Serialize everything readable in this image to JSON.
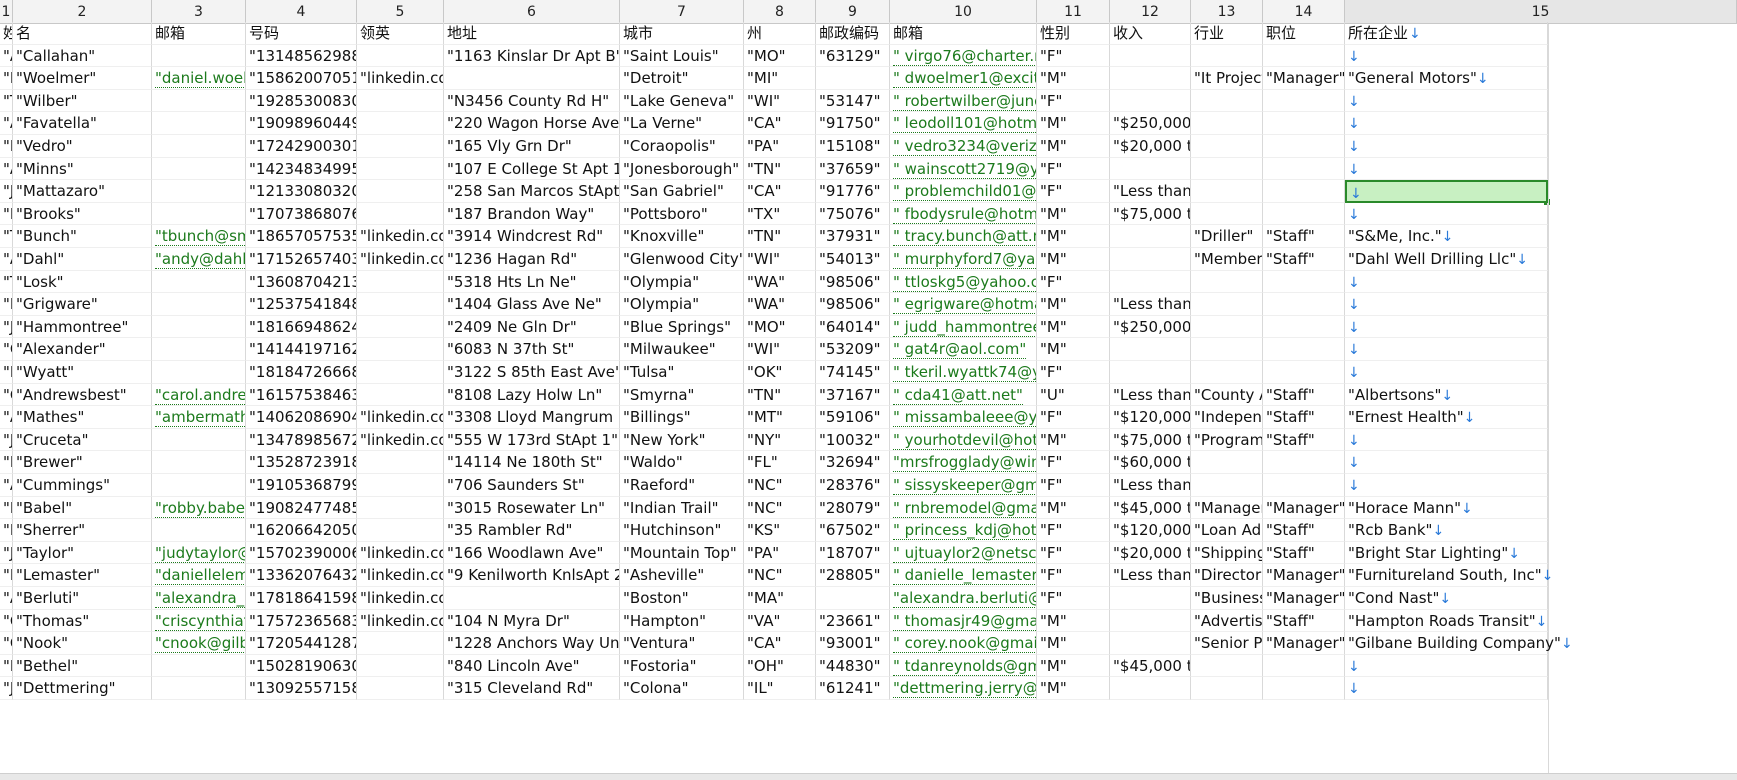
{
  "column_numbers": [
    "1",
    "2",
    "3",
    "4",
    "5",
    "6",
    "7",
    "8",
    "9",
    "10",
    "11",
    "12",
    "13",
    "14",
    "15"
  ],
  "headers": [
    "姓",
    "名",
    "邮箱",
    "号码",
    "领英",
    "地址",
    "城市",
    "州",
    "邮政编码",
    "邮箱",
    "性别",
    "收入",
    "行业",
    "职位",
    "所在企业"
  ],
  "rows": [
    [
      "\"Am",
      "\"Callahan\"",
      "",
      "\"13148562988\"",
      "",
      "\"1163 Kinslar Dr Apt B\"",
      "\"Saint Louis\"",
      "\"MO\"",
      "\"63129\"",
      "\" virgo76@charter.ne",
      "\"F\"",
      "",
      "",
      "",
      ""
    ],
    [
      "\"Da",
      "\"Woelmer\"",
      "\"daniel.woelm",
      "\"15862007051\"",
      "\"linkedin.con",
      "",
      "\"Detroit\"",
      "\"MI\"",
      "",
      "\" dwoelmer1@excite.",
      "\"M\"",
      "",
      "\"It Project",
      "\"Manager\"",
      "\"General Motors\""
    ],
    [
      "\"Tar",
      "\"Wilber\"",
      "",
      "\"19285300830\"",
      "",
      "\"N3456 County Rd H\"",
      "\"Lake Geneva\"",
      "\"WI\"",
      "\"53147\"",
      "\" robertwilber@juno.",
      "\"F\"",
      "",
      "",
      "",
      ""
    ],
    [
      "\"Aar",
      "\"Favatella\"",
      "",
      "\"19098960449\"",
      "",
      "\"220 Wagon Horse Ave\"",
      "\"La Verne\"",
      "\"CA\"",
      "\"91750\"",
      "\" leodoll101@hotmai",
      "\"M\"",
      "\"$250,000+",
      "",
      "",
      ""
    ],
    [
      "\"Pat",
      "\"Vedro\"",
      "",
      "\"17242900301\"",
      "",
      "\"165 Vly Grn Dr\"",
      "\"Coraopolis\"",
      "\"PA\"",
      "\"15108\"",
      "\" vedro3234@verizor",
      "\"M\"",
      "\"$20,000 to",
      "",
      "",
      ""
    ],
    [
      "\"Apr",
      "\"Minns\"",
      "",
      "\"14234834995\"",
      "",
      "\"107 E College St Apt 15\"",
      "\"Jonesborough\"",
      "\"TN\"",
      "\"37659\"",
      "\" wainscott2719@yah",
      "\"F\"",
      "",
      "",
      "",
      ""
    ],
    [
      "\"Jos",
      "\"Mattazaro\"",
      "",
      "\"12133080320\"",
      "",
      "\"258 San Marcos StApt K",
      "\"San Gabriel\"",
      "\"CA\"",
      "\"91776\"",
      "\" problemchild01@g",
      "\"F\"",
      "\"Less than $",
      "",
      "",
      ""
    ],
    [
      "\"Dav",
      "\"Brooks\"",
      "",
      "\"17073868076\"",
      "",
      "\"187 Brandon Way\"",
      "\"Pottsboro\"",
      "\"TX\"",
      "\"75076\"",
      "\" fbodysrule@hotma",
      "\"M\"",
      "\"$75,000 to",
      "",
      "",
      ""
    ],
    [
      "\"Tra",
      "\"Bunch\"",
      "\"tbunch@sme",
      "\"18657057535\"",
      "\"linkedin.con",
      "\"3914 Windcrest Rd\"",
      "\"Knoxville\"",
      "\"TN\"",
      "\"37931\"",
      "\" tracy.bunch@att.ne",
      "\"M\"",
      "",
      "\"Driller\"",
      "\"Staff\"",
      "\"S&Me, Inc.\""
    ],
    [
      "\"And",
      "\"Dahl\"",
      "\"andy@dahlw",
      "\"17152657403\"",
      "\"linkedin.con",
      "\"1236 Hagan Rd\"",
      "\"Glenwood City\"",
      "\"WI\"",
      "\"54013\"",
      "\" murphyford7@yaho",
      "\"M\"",
      "",
      "\"Member\"",
      "\"Staff\"",
      "\"Dahl Well Drilling Llc\""
    ],
    [
      "\"Tar",
      "\"Losk\"",
      "",
      "\"13608704213\"",
      "",
      "\"5318 Hts Ln Ne\"",
      "\"Olympia\"",
      "\"WA\"",
      "\"98506\"",
      "\" ttloskg5@yahoo.co",
      "\"F\"",
      "",
      "",
      "",
      ""
    ],
    [
      "\"Mic",
      "\"Grigware\"",
      "",
      "\"12537541848\"",
      "",
      "\"1404 Glass Ave Ne\"",
      "\"Olympia\"",
      "\"WA\"",
      "\"98506\"",
      "\" egrigware@hotmai",
      "\"M\"",
      "\"Less than $",
      "",
      "",
      ""
    ],
    [
      "\"Jud",
      "\"Hammontree\"",
      "",
      "\"18166948624\"",
      "",
      "\"2409 Ne Gln Dr\"",
      "\"Blue Springs\"",
      "\"MO\"",
      "\"64014\"",
      "\" judd_hammontree8",
      "\"M\"",
      "\"$250,000+",
      "",
      "",
      ""
    ],
    [
      "\"Gat",
      "\"Alexander\"",
      "",
      "\"14144197162\"",
      "",
      "\"6083 N 37th St\"",
      "\"Milwaukee\"",
      "\"WI\"",
      "\"53209\"",
      "\" gat4r@aol.com\"",
      "\"M\"",
      "",
      "",
      "",
      ""
    ],
    [
      "\"Ker",
      "\"Wyatt\"",
      "",
      "\"18184726668\"",
      "",
      "\"3122 S 85th East Ave\"",
      "\"Tulsa\"",
      "\"OK\"",
      "\"74145\"",
      "\" tkeril.wyattk74@yal",
      "\"F\"",
      "",
      "",
      "",
      ""
    ],
    [
      "\"Car",
      "\"Andrewsbest\"",
      "\"carol.andrew",
      "\"16157538463\"",
      "",
      "\"8108 Lazy Holw Ln\"",
      "\"Smyrna\"",
      "\"TN\"",
      "\"37167\"",
      "\" cda41@att.net\"",
      "\"U\"",
      "\"Less than $",
      "\"County A",
      "\"Staff\"",
      "\"Albertsons\""
    ],
    [
      "\"Am",
      "\"Mathes\"",
      "\"ambermathe",
      "\"14062086904\"",
      "\"linkedin.con",
      "\"3308 Lloyd Mangrum Ln",
      "\"Billings\"",
      "\"MT\"",
      "\"59106\"",
      "\" missambaleee@yah",
      "\"F\"",
      "\"$120,000 t",
      "\"Independ",
      "\"Staff\"",
      "\"Ernest Health\""
    ],
    [
      "\"Jos",
      "\"Cruceta\"",
      "",
      "\"13478985672\"",
      "\"linkedin.con",
      "\"555 W 173rd StApt 1\"",
      "\"New York\"",
      "\"NY\"",
      "\"10032\"",
      "\" yourhotdevil@hotn",
      "\"M\"",
      "\"$75,000 to",
      "\"Programn",
      "\"Staff\"",
      ""
    ],
    [
      "\"Ker",
      "\"Brewer\"",
      "",
      "\"13528723918\"",
      "",
      "\"14114 Ne 180th St\"",
      "\"Waldo\"",
      "\"FL\"",
      "\"32694\"",
      "\"mrsfrogglady@wind",
      "\"F\"",
      "\"$60,000 to",
      "",
      "",
      ""
    ],
    [
      "\"Aur",
      "\"Cummings\"",
      "",
      "\"19105368799\"",
      "",
      "\"706 Saunders St\"",
      "\"Raeford\"",
      "\"NC\"",
      "\"28376\"",
      "\" sissyskeeper@gmai",
      "\"F\"",
      "\"Less than $",
      "",
      "",
      ""
    ],
    [
      "\"Rol",
      "\"Babel\"",
      "\"robby.babel@",
      "\"19082477485\"",
      "",
      "\"3015 Rosewater Ln\"",
      "\"Indian Trail\"",
      "\"NC\"",
      "\"28079\"",
      "\" rnbremodel@gmail",
      "\"M\"",
      "\"$45,000 to",
      "\"Manager\"",
      "\"Manager\"",
      "\"Horace Mann\""
    ],
    [
      "\"Kris",
      "\"Sherrer\"",
      "",
      "\"16206642050\"",
      "",
      "\"35 Rambler Rd\"",
      "\"Hutchinson\"",
      "\"KS\"",
      "\"67502\"",
      "\" princess_kdj@hotm",
      "\"F\"",
      "\"$120,000 t",
      "\"Loan Adm",
      "\"Staff\"",
      "\"Rcb Bank\""
    ],
    [
      "\"Jud",
      "\"Taylor\"",
      "\"judytaylor@f",
      "\"15702390006\"",
      "\"linkedin.con",
      "\"166 Woodlawn Ave\"",
      "\"Mountain Top\"",
      "\"PA\"",
      "\"18707\"",
      "\" ujtuaylor2@netscap",
      "\"F\"",
      "\"$20,000 to",
      "\"Shipping\"",
      "\"Staff\"",
      "\"Bright Star Lighting\""
    ],
    [
      "\"Dar",
      "\"Lemaster\"",
      "\"daniellelema",
      "\"13362076432\"",
      "\"linkedin.con",
      "\"9 Kenilworth KnlsApt 20",
      "\"Asheville\"",
      "\"NC\"",
      "\"28805\"",
      "\" danielle_lemaster@",
      "\"F\"",
      "\"Less than $",
      "\"Director C",
      "\"Manager\"",
      "\"Furnitureland South, Inc\""
    ],
    [
      "\"Ale",
      "\"Berluti\"",
      "\"alexandra_be",
      "\"17818641598\"",
      "\"linkedin.con",
      "",
      "\"Boston\"",
      "\"MA\"",
      "",
      "\"alexandra.berluti@g",
      "\"F\"",
      "",
      "\"Business I",
      "\"Manager\"",
      "\"Cond Nast\""
    ],
    [
      "\"Cris",
      "\"Thomas\"",
      "\"criscynthiath",
      "\"17572365683\"",
      "\"linkedin.con",
      "\"104 N Myra Dr\"",
      "\"Hampton\"",
      "\"VA\"",
      "\"23661\"",
      "\" thomasjr49@gmail.",
      "\"M\"",
      "",
      "\"Advertisir",
      "\"Staff\"",
      "\"Hampton Roads Transit\""
    ],
    [
      "\"Cor",
      "\"Nook\"",
      "\"cnook@gilba",
      "\"17205441287\"",
      "",
      "\"1228 Anchors Way Unit",
      "\"Ventura\"",
      "\"CA\"",
      "\"93001\"",
      "\" corey.nook@gmail.c",
      "\"M\"",
      "",
      "\"Senior Pr",
      "\"Manager\"",
      "\"Gilbane Building Company\""
    ],
    [
      "\"Dar",
      "\"Bethel\"",
      "",
      "\"15028190630\"",
      "",
      "\"840 Lincoln Ave\"",
      "\"Fostoria\"",
      "\"OH\"",
      "\"44830\"",
      "\" tdanreynolds@gma",
      "\"M\"",
      "\"$45,000 to",
      "",
      "",
      ""
    ],
    [
      "\"Jer",
      "\"Dettmering\"",
      "",
      "\"13092557158\"",
      "",
      "\"315 Cleveland Rd\"",
      "\"Colona\"",
      "\"IL\"",
      "\"61241\"",
      "\"dettmering.jerry@iw",
      "\"M\"",
      "",
      "",
      "",
      ""
    ]
  ],
  "arrow_glyph": "↓",
  "accent_color": "#2a8a2a",
  "link_color": "#1c7a1c"
}
